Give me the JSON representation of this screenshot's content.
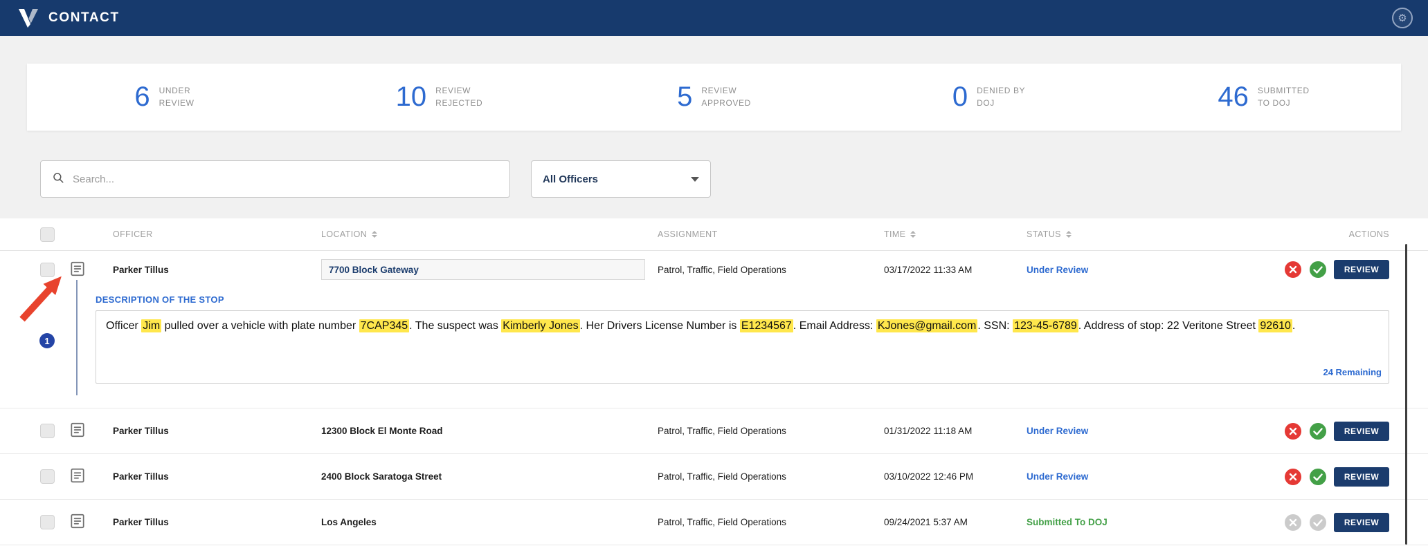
{
  "topbar": {
    "title": "CONTACT"
  },
  "icons": {
    "topbar_logo": "veritone-logo",
    "topbar_settings": "gear-icon",
    "search": "search-icon",
    "dropdown": "chevron-down-icon",
    "sort": "sort-arrows-icon",
    "row_description": "document-icon",
    "reject": "x-circle-icon",
    "approve": "check-circle-icon"
  },
  "colors": {
    "topbar_navy": "#173a6d",
    "navy": "#1b3c6d",
    "accent_blue": "#2d6ad0",
    "green": "#43a047",
    "red": "#e53935",
    "highlight": "#ffe74c",
    "annotation_red": "#e8432d",
    "badge_blue": "#2444a6"
  },
  "stats": [
    {
      "value": "6",
      "label_line1": "UNDER",
      "label_line2": "REVIEW"
    },
    {
      "value": "10",
      "label_line1": "REVIEW",
      "label_line2": "REJECTED"
    },
    {
      "value": "5",
      "label_line1": "REVIEW",
      "label_line2": "APPROVED"
    },
    {
      "value": "0",
      "label_line1": "DENIED BY",
      "label_line2": "DOJ"
    },
    {
      "value": "46",
      "label_line1": "SUBMITTED",
      "label_line2": "TO DOJ"
    }
  ],
  "filters": {
    "search_placeholder": "Search...",
    "officer_filter": "All Officers"
  },
  "table": {
    "headers": {
      "officer": "OFFICER",
      "location": "LOCATION",
      "assignment": "ASSIGNMENT",
      "time": "TIME",
      "status": "STATUS",
      "actions": "ACTIONS"
    },
    "sortable_columns": [
      "location",
      "time",
      "status"
    ],
    "rows": [
      {
        "officer": "Parker Tillus",
        "location": "7700 Block Gateway",
        "location_editable": true,
        "assignment": "Patrol, Traffic, Field Operations",
        "time": "03/17/2022 11:33 AM",
        "status": "Under Review",
        "status_color": "#2d6ad0",
        "actions_enabled": true,
        "review_label": "REVIEW",
        "expanded": true,
        "expanded_content": {
          "label": "DESCRIPTION OF THE STOP",
          "segments": [
            {
              "text": "Officer ",
              "highlight": false
            },
            {
              "text": "Jim",
              "highlight": true
            },
            {
              "text": " pulled over a vehicle with plate number ",
              "highlight": false
            },
            {
              "text": "7CAP345",
              "highlight": true
            },
            {
              "text": ". The suspect was ",
              "highlight": false
            },
            {
              "text": "Kimberly Jones",
              "highlight": true
            },
            {
              "text": ". Her Drivers License Number is ",
              "highlight": false
            },
            {
              "text": "E1234567",
              "highlight": true
            },
            {
              "text": ". Email Address: ",
              "highlight": false
            },
            {
              "text": "KJones@gmail.com",
              "highlight": true
            },
            {
              "text": ". SSN: ",
              "highlight": false
            },
            {
              "text": "123-45-6789",
              "highlight": true
            },
            {
              "text": ". Address of stop: 22 Veritone Street ",
              "highlight": false
            },
            {
              "text": "92610",
              "highlight": true
            },
            {
              "text": ".",
              "highlight": false
            }
          ],
          "remaining": "24 Remaining"
        }
      },
      {
        "officer": "Parker Tillus",
        "location": "12300 Block El Monte Road",
        "location_editable": false,
        "assignment": "Patrol, Traffic, Field Operations",
        "time": "01/31/2022 11:18 AM",
        "status": "Under Review",
        "status_color": "#2d6ad0",
        "actions_enabled": true,
        "review_label": "REVIEW",
        "expanded": false
      },
      {
        "officer": "Parker Tillus",
        "location": "2400 Block Saratoga Street",
        "location_editable": false,
        "assignment": "Patrol, Traffic, Field Operations",
        "time": "03/10/2022 12:46 PM",
        "status": "Under Review",
        "status_color": "#2d6ad0",
        "actions_enabled": true,
        "review_label": "REVIEW",
        "expanded": false
      },
      {
        "officer": "Parker Tillus",
        "location": "Los Angeles",
        "location_editable": false,
        "assignment": "Patrol, Traffic, Field Operations",
        "time": "09/24/2021 5:37 AM",
        "status": "Submitted To DOJ",
        "status_color": "#43a047",
        "actions_enabled": false,
        "review_label": "REVIEW",
        "expanded": false
      }
    ]
  },
  "annotations": {
    "step_badge": "1"
  }
}
